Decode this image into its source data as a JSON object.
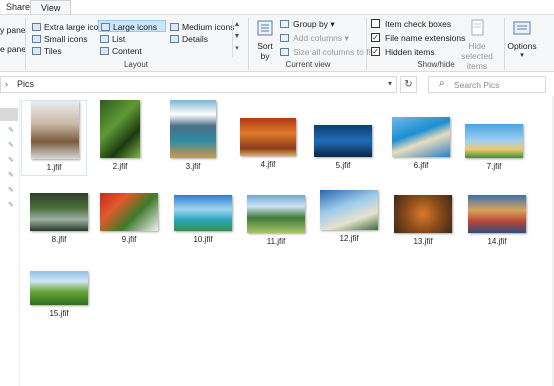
{
  "tabs": {
    "share": "Share",
    "view": "View"
  },
  "panes": {
    "label_top": "y pane",
    "label_bottom": "e pane"
  },
  "layout": {
    "group_label": "Layout",
    "items": [
      "Extra large icons",
      "Large icons",
      "Medium icons",
      "Small icons",
      "List",
      "Details",
      "Tiles",
      "Content"
    ],
    "selected": "Large icons"
  },
  "current_view": {
    "group_label": "Current view",
    "sort_label_1": "Sort",
    "sort_label_2": "by",
    "group_by": "Group by",
    "add_columns": "Add columns",
    "size_columns": "Size all columns to fit"
  },
  "show_hide": {
    "group_label": "Show/hide",
    "item_check_boxes": {
      "label": "Item check boxes",
      "checked": false
    },
    "file_name_extensions": {
      "label": "File name extensions",
      "checked": true
    },
    "hidden_items": {
      "label": "Hidden items",
      "checked": true
    },
    "hide_selected_1": "Hide selected",
    "hide_selected_2": "items"
  },
  "options": {
    "label": "Options"
  },
  "address": {
    "crumb": "Pics"
  },
  "search": {
    "placeholder": "Search Pics"
  },
  "files": [
    {
      "name": "1.jfif",
      "icon": "deer-photo",
      "selected": true
    },
    {
      "name": "2.jfif",
      "icon": "leaves-photo"
    },
    {
      "name": "3.jfif",
      "icon": "mountain-lake-photo"
    },
    {
      "name": "4.jfif",
      "icon": "autumn-forest-photo"
    },
    {
      "name": "5.jfif",
      "icon": "underwater-photo"
    },
    {
      "name": "6.jfif",
      "icon": "coast-cliff-photo"
    },
    {
      "name": "7.jfif",
      "icon": "beach-sky-photo"
    },
    {
      "name": "8.jfif",
      "icon": "bridge-reflection-photo"
    },
    {
      "name": "9.jfif",
      "icon": "squirrel-flowers-photo"
    },
    {
      "name": "10.jfif",
      "icon": "tropical-bay-photo"
    },
    {
      "name": "11.jfif",
      "icon": "green-peaks-photo"
    },
    {
      "name": "12.jfif",
      "icon": "palm-beach-photo"
    },
    {
      "name": "13.jfif",
      "icon": "fox-photo"
    },
    {
      "name": "14.jfif",
      "icon": "coastal-town-photo"
    },
    {
      "name": "15.jfif",
      "icon": "tea-field-photo"
    }
  ]
}
